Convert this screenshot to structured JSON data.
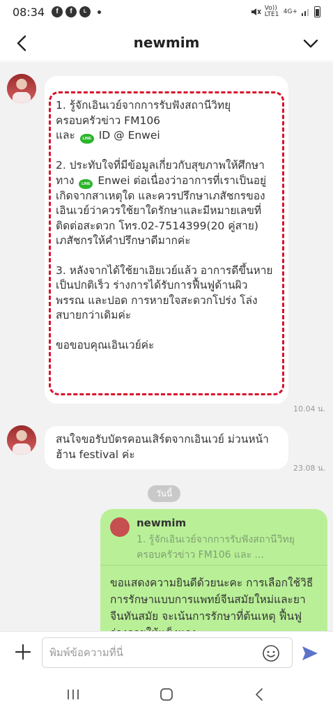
{
  "status_bar": {
    "time": "08:34",
    "net_label": "Vo)) LTE1",
    "net_type": "4G+",
    "icons": [
      "facebook-icon",
      "facebook-icon",
      "line-icon",
      "dot-icon",
      "mute-icon",
      "signal-icon",
      "battery-icon"
    ]
  },
  "header": {
    "title": "newmim"
  },
  "messages": [
    {
      "direction": "incoming",
      "paragraphs": {
        "p1a": "1. รู้จักเอินเวย์จากการรับฟังสถานีวิทยุครอบครัวข่าว FM106",
        "p1b_pre": "และ",
        "p1b_post": "ID @ Enwei",
        "p2_pre": "2. ประทับใจที่มีข้อมูลเกี่ยวกับสุขภาพให้ศึกษาทาง",
        "p2_post": "Enwei ต่อเนื่องว่าอาการที่เราเป็นอยู่เกิดจากสาเหตุใด และควรปรึกษาเภสัชกรของเอินเวย์ว่าควรใช้ยาใดรักษาและมีหมายเลขที่ติดต่อสะดวก โทร.02-7514399(20 คู่สาย) เภสัชกรให้คำปรึกษาดีมากค่ะ",
        "p3": "3. หลังจากได้ใช้ยาเอิยเวย์แล้ว อาการดีขึ้นหายเป็นปกติเร็ว ร่างการได้รับการฟื้นฟูด้านผิวพรรณ และปอด การหายใจสะดวกโปร่ง โล่งสบายกว่าเดิมค่ะ",
        "p4": "ขอขอบคุณเอินเวย์ค่ะ"
      },
      "line_icon_label": "LINE",
      "timestamp": "10.04 น."
    },
    {
      "direction": "incoming",
      "text": "สนใจขอรับบัตรคอนเสิร์ตจากเอินเวย์ ม่วนหน้าฮ้าน festival ค่ะ",
      "timestamp": "23.08 น."
    }
  ],
  "date_divider": "วันนี้",
  "reply": {
    "quoted_name": "newmim",
    "quoted_snippet": "1. รู้จักเอินเวย์จากการรับฟังสถานีวิทยุครอบครัวข่าว FM106 และ ...",
    "body": "ขอแสดงความยินดีด้วยนะคะ การเลือกใช้วิธีการรักษาแบบการแพทย์จีนสมัยใหม่และยาจีนทันสมัย จะเน้นการรักษาที่ต้นเหตุ ฟื้นฟูร่างกายให้แข็งแรง"
  },
  "input": {
    "placeholder": "พิมพ์ข้อความที่นี่"
  },
  "colors": {
    "accent_line_green": "#2bb52b",
    "outgoing_bubble": "#b9f097",
    "highlight_dashed": "#d8112b",
    "send_button": "#5b74c9"
  }
}
